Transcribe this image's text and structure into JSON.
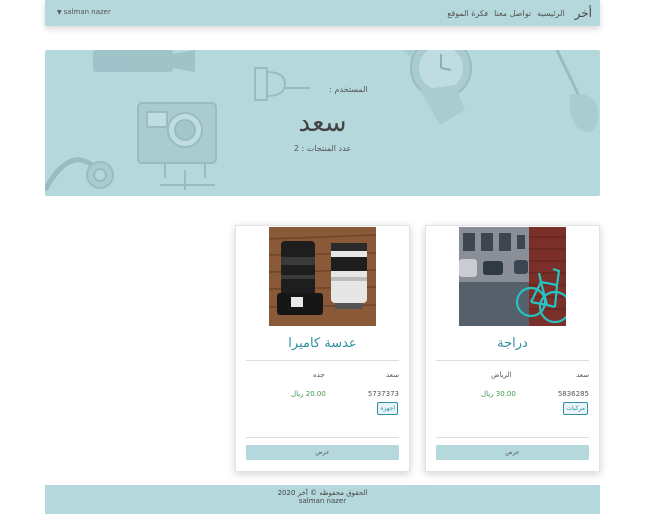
{
  "navbar": {
    "brand": "أخر",
    "links": [
      "الرئيسيه",
      "تواصل معنا",
      "فكرة الموقع"
    ],
    "user": "salman nazer"
  },
  "hero": {
    "label": "المستخدم :",
    "name": "سعد",
    "count": "عدد المنتجات : 2"
  },
  "products": [
    {
      "title": "دراجة",
      "owner": "سعد",
      "city": "الرياض",
      "phone": "5836285",
      "price": "30.00 ريال",
      "category": "مركبات",
      "view_label": "عرض"
    },
    {
      "title": "عدسة كاميرا",
      "owner": "سعد",
      "city": "جده",
      "phone": "5737373",
      "price": "20.00 ريال",
      "category": "اجهزه",
      "view_label": "عرض"
    }
  ],
  "footer": {
    "copyright": "الحقوق محفوظه © آخر 2020",
    "author": "salman nazer"
  },
  "colors": {
    "accent": "#b5d8dc",
    "title": "#2f8fa3",
    "price": "#3d9a4a"
  }
}
